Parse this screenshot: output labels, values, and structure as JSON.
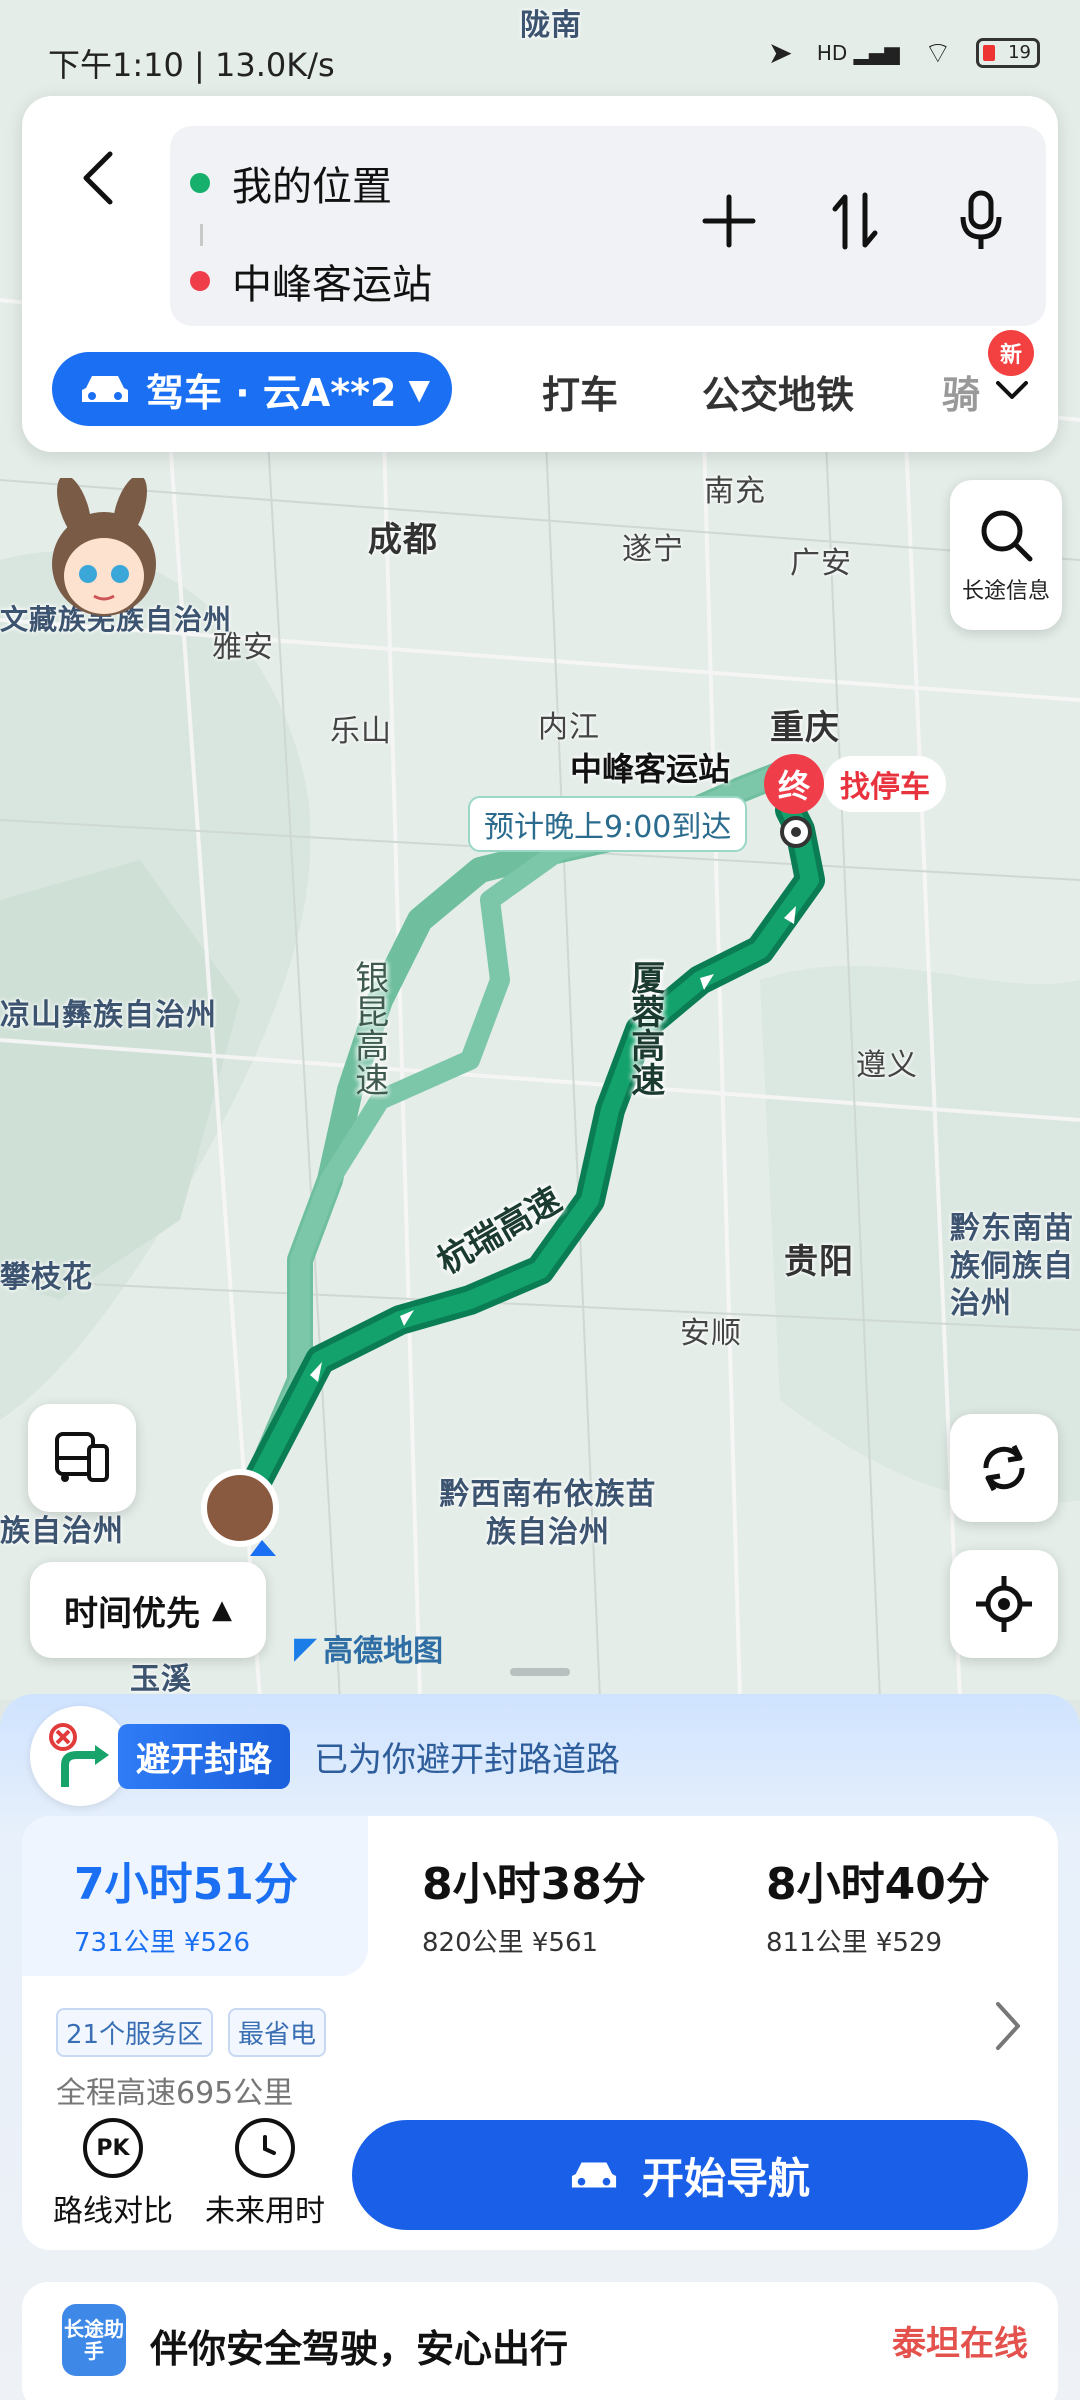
{
  "status": {
    "time": "下午1:10",
    "speed": "13.0K/s",
    "battery": "19",
    "network": "HD"
  },
  "search": {
    "origin": "我的位置",
    "destination": "中峰客运站"
  },
  "modes": {
    "drive": "驾车 · 云A**2",
    "taxi": "打车",
    "transit": "公交地铁",
    "ride": "骑",
    "new_badge": "新"
  },
  "map": {
    "cities": [
      {
        "name": "成都"
      },
      {
        "name": "南充"
      },
      {
        "name": "遂宁"
      },
      {
        "name": "广安"
      },
      {
        "name": "雅安"
      },
      {
        "name": "乐山"
      },
      {
        "name": "内江"
      },
      {
        "name": "重庆"
      },
      {
        "name": "遵义"
      },
      {
        "name": "贵阳"
      },
      {
        "name": "安顺"
      }
    ],
    "regions": [
      "凉山彝族自治州",
      "攀枝花",
      "黔西南布依族苗族自治州",
      "黔东南苗族侗族自治州",
      "族自治州",
      "文藏族羌族自治州",
      "玉溪",
      "陇南"
    ],
    "roads": [
      "厦蓉高速",
      "杭瑞高速",
      "银昆高速"
    ],
    "destination_label": "中峰客运站",
    "destination_pin": "终",
    "find_parking": "找停车",
    "eta": "预计晚上9:00到达",
    "long_trip_info": "长途信息",
    "priority": "时间优先",
    "amap": "高德地图"
  },
  "sheet": {
    "avoid_badge": "避开封路",
    "avoid_text": "已为你避开封路道路",
    "routes": [
      {
        "time": "7小时51分",
        "meta": "731公里  ¥526",
        "selected": true
      },
      {
        "time": "8小时38分",
        "meta": "820公里  ¥561",
        "selected": false
      },
      {
        "time": "8小时40分",
        "meta": "811公里  ¥529",
        "selected": false
      }
    ],
    "tags": [
      "21个服务区",
      "最省电"
    ],
    "highway_note": "全程高速695公里",
    "tools": {
      "compare": "路线对比",
      "future": "未来用时",
      "compare_icon": "PK"
    },
    "start_nav": "开始导航",
    "assistant_icon": "长途助手",
    "assistant_text": "伴你安全驾驶，安心出行",
    "watermark": "泰坦在线"
  },
  "colors": {
    "accent": "#1a6ff2",
    "route_main": "#0f8a5f",
    "route_alt": "#5cb392",
    "dest": "#ef3e49"
  }
}
